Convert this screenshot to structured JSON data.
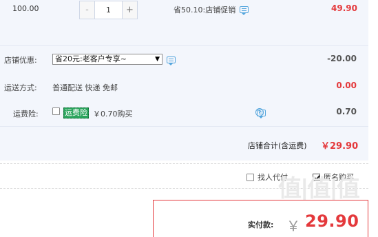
{
  "product_row": {
    "price": "100.00",
    "quantity": "1",
    "minus_label": "-",
    "plus_label": "+",
    "promo_text": "省50.10:店铺促销",
    "subtotal": "49.90"
  },
  "shop": {
    "discount_label": "店铺优惠:",
    "discount_selected": "省20元:老客户专享~",
    "discount_value": "-20.00",
    "shipping_label": "运送方式:",
    "shipping_text": "普通配送 快递 免邮",
    "shipping_value": "0.00",
    "insurance_label": "运费险:",
    "insurance_badge": "运费险",
    "insurance_text": "￥0.70购买",
    "insurance_value": "0.70",
    "total_label": "店铺合计(含运费)",
    "total_value": "￥29.90"
  },
  "options": {
    "proxy_pay": "找人代付",
    "anonymous": "匿名购买"
  },
  "payment": {
    "label": "实付款:",
    "currency": "￥",
    "amount": "29.90"
  },
  "watermark": "值|值|值",
  "colors": {
    "accent_red": "#e4393c",
    "panel_bg": "#f3f6fc",
    "link_blue": "#55a6dd",
    "badge_green": "#2aa45c"
  }
}
